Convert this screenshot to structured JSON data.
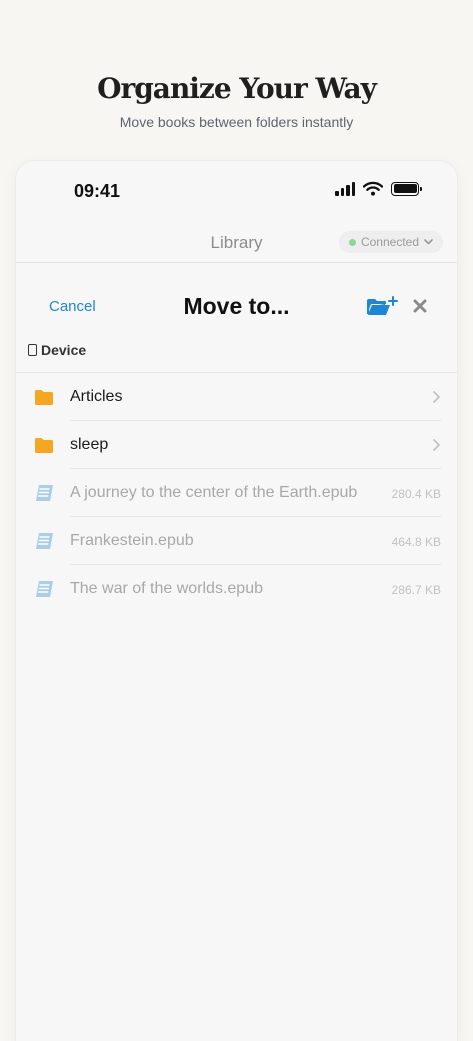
{
  "hero": {
    "title": "Organize Your Way",
    "subtitle": "Move books between folders instantly"
  },
  "status_bar": {
    "time": "09:41"
  },
  "library": {
    "title": "Library",
    "connection_status": "Connected"
  },
  "sheet": {
    "cancel_label": "Cancel",
    "title": "Move to...",
    "section_label": "Device"
  },
  "items": [
    {
      "type": "folder",
      "label": "Articles"
    },
    {
      "type": "folder",
      "label": "sleep"
    },
    {
      "type": "book",
      "label": "A journey to the center of the Earth.epub",
      "size": "280.4 KB"
    },
    {
      "type": "book",
      "label": "Frankestein.epub",
      "size": "464.8 KB"
    },
    {
      "type": "book",
      "label": "The war of the worlds.epub",
      "size": "286.7 KB"
    }
  ],
  "colors": {
    "accent": "#1e86d8",
    "folder": "#f5a623",
    "book_icon": "#a9cdef",
    "connected_dot": "#8fd49a"
  }
}
